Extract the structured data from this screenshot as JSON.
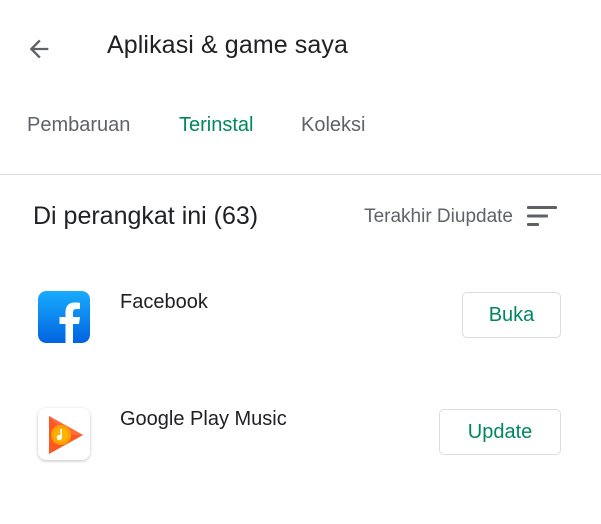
{
  "header": {
    "back_icon": "arrow-back-icon",
    "title": "Aplikasi & game saya"
  },
  "tabs": [
    {
      "label": "Pembaruan",
      "active": false
    },
    {
      "label": "Terinstal",
      "active": true
    },
    {
      "label": "Koleksi",
      "active": false
    }
  ],
  "section": {
    "title": "Di perangkat ini (63)",
    "sort_label": "Terakhir Diupdate",
    "sort_icon": "sort-icon"
  },
  "apps": [
    {
      "name": "Facebook",
      "icon": "facebook-icon",
      "action": "Buka"
    },
    {
      "name": "Google Play Music",
      "icon": "google-play-music-icon",
      "action": "Update"
    }
  ],
  "colors": {
    "accent": "#01875f",
    "text_primary": "#202124",
    "text_secondary": "#5f6368",
    "divider": "#dadce0",
    "facebook_blue": "#1877f2",
    "music_orange": "#ff5722"
  }
}
